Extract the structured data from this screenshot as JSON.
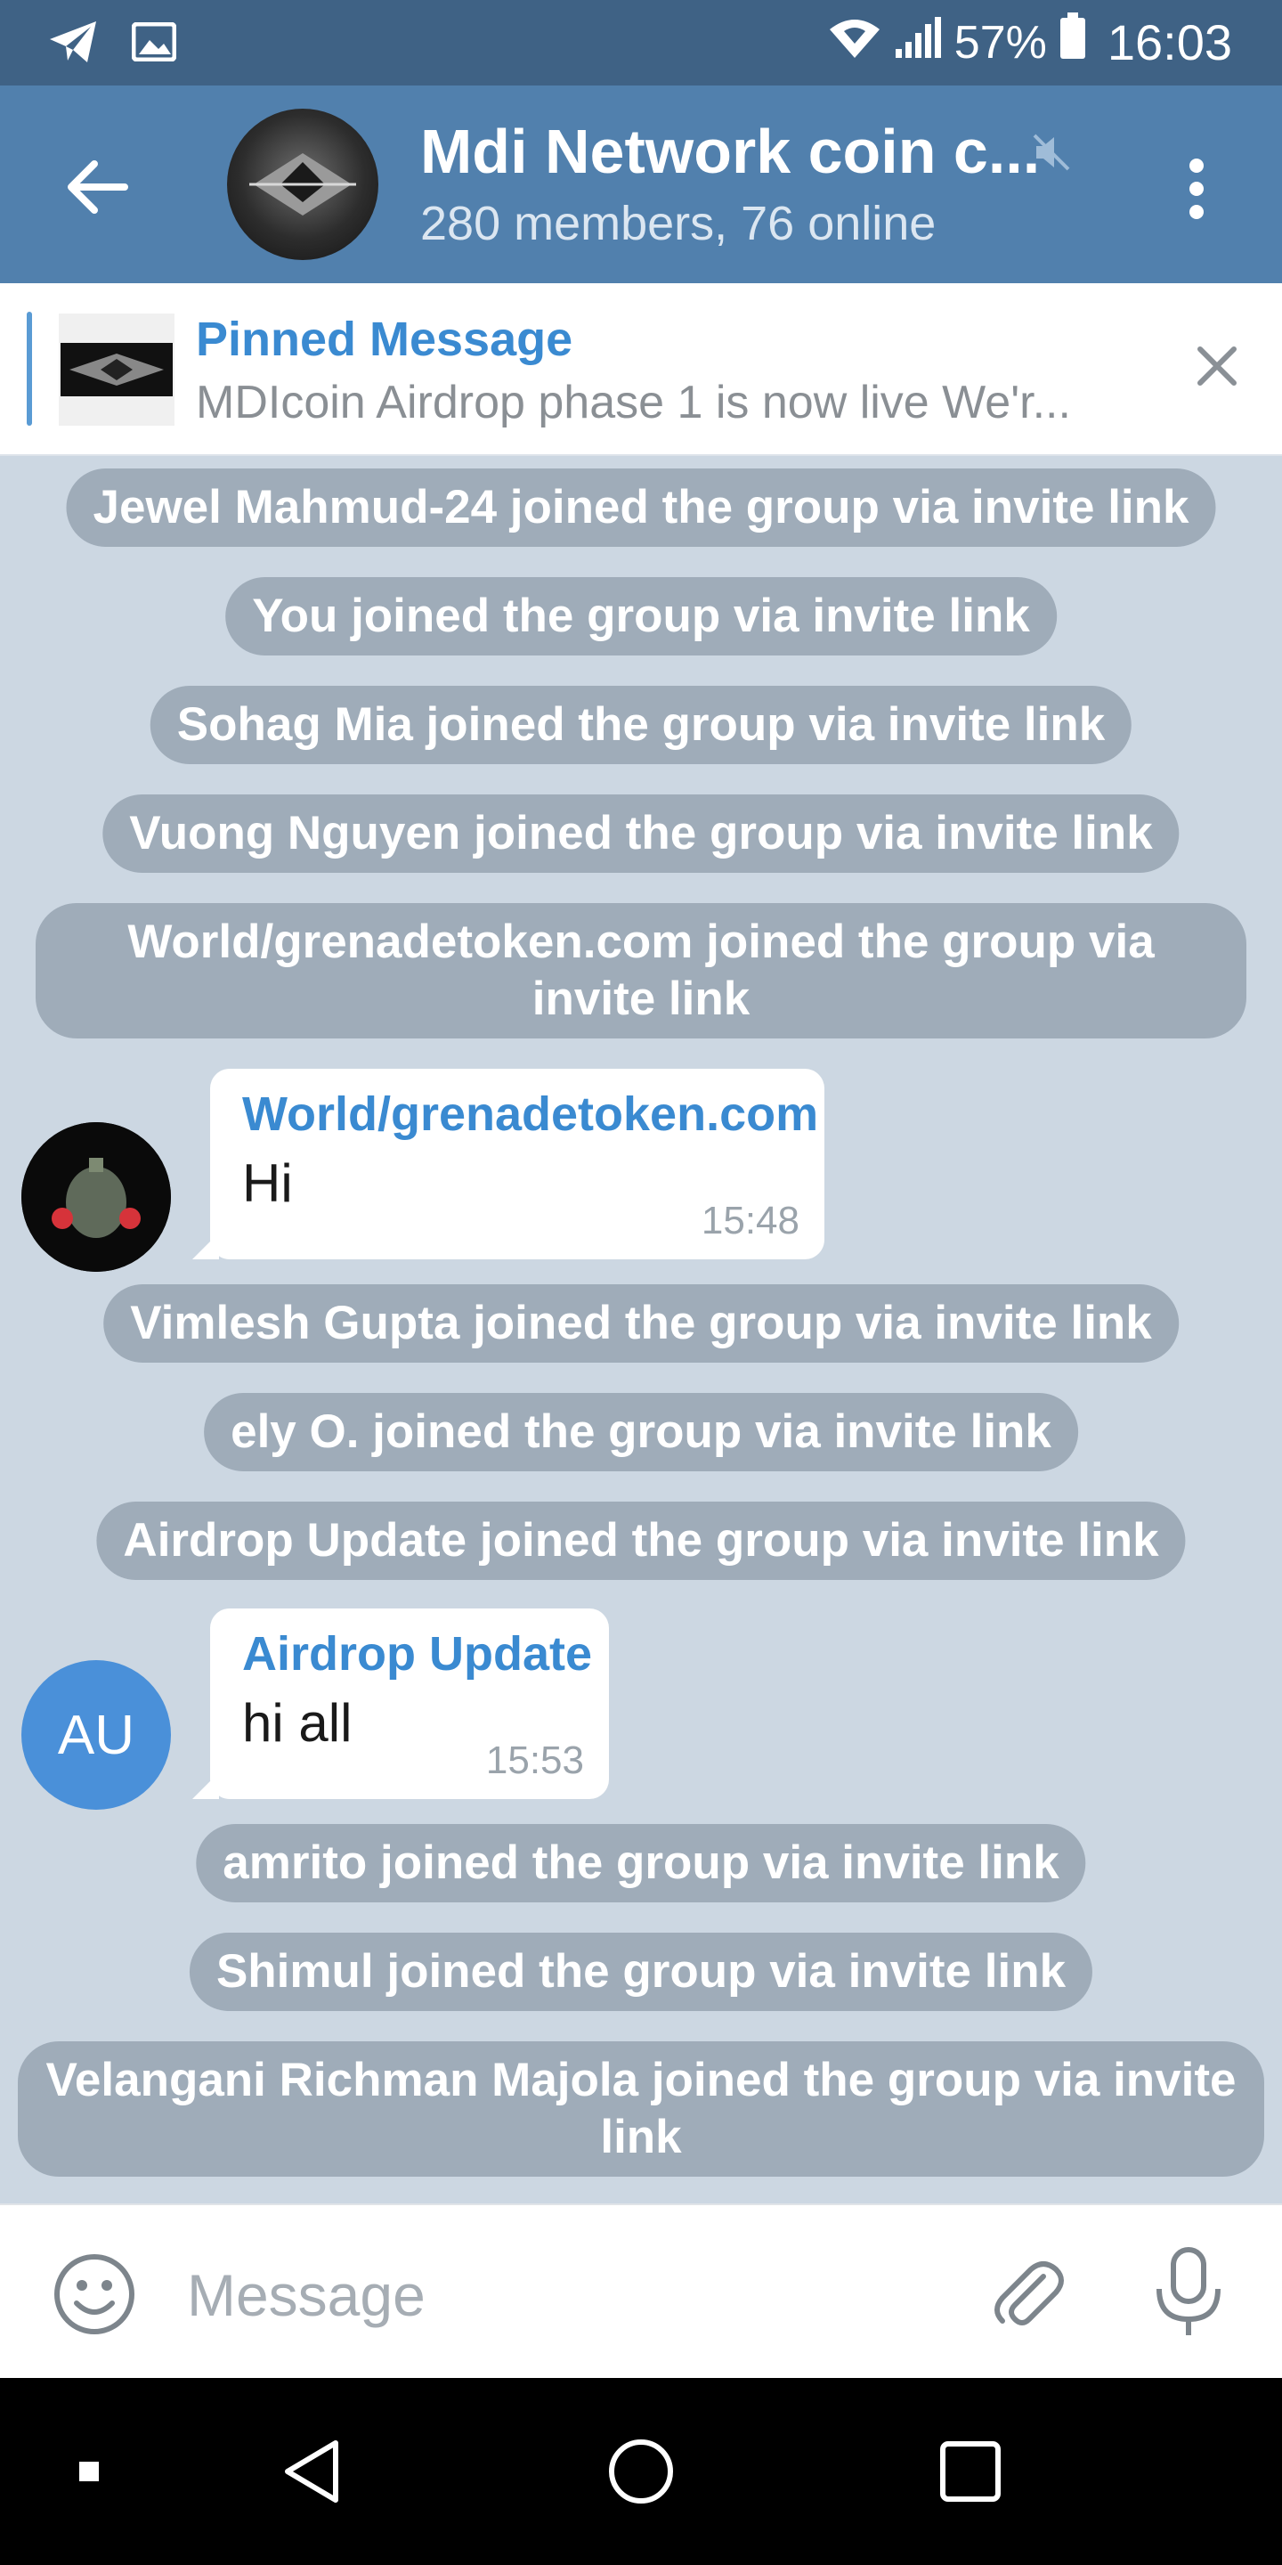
{
  "status_bar": {
    "battery_percent": "57%",
    "time": "16:03",
    "icons": [
      "telegram-icon",
      "image-icon",
      "wifi-icon",
      "signal-icon",
      "battery-icon"
    ]
  },
  "header": {
    "title": "Mdi Network coin c...",
    "subtitle": "280 members, 76 online",
    "muted": true,
    "colors": {
      "bar": "#5180ad",
      "status": "#3f6285"
    }
  },
  "pinned": {
    "label": "Pinned Message",
    "text": "MDIcoin Airdrop phase 1 is now live We'r..."
  },
  "chat": {
    "events": [
      "Jewel Mahmud-24 joined the group via invite link",
      "You joined the group via invite link",
      "Sohag Mia joined the group via invite link",
      "Vuong Nguyen joined the group via invite link",
      "World/grenadetoken.com joined the group via invite link",
      "Vimlesh Gupta joined the group via invite link",
      "ely O. joined the group via invite link",
      "Airdrop Update joined the group via invite link",
      "amrito joined the group via invite link",
      "Shimul joined the group via invite link",
      "Velangani Richman Majola joined the group via invite link"
    ],
    "messages": [
      {
        "sender": "World/grenadetoken.com",
        "text": "Hi",
        "time": "15:48"
      },
      {
        "sender": "Airdrop Update",
        "avatar_initials": "AU",
        "text": "hi all",
        "time": "15:53"
      }
    ]
  },
  "input": {
    "placeholder": "Message"
  },
  "accent": "#3a8ad1"
}
